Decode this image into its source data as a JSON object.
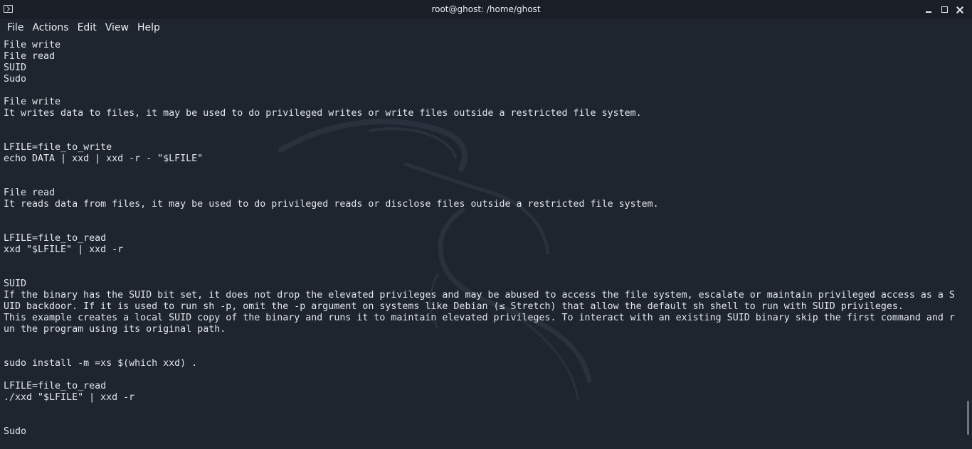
{
  "window": {
    "title": "root@ghost: /home/ghost"
  },
  "icons": {
    "app": "terminal-icon",
    "minimize": "minimize-icon",
    "maximize": "maximize-icon",
    "close": "close-icon"
  },
  "colors": {
    "background": "#1e252f",
    "titlebar": "#1a1f27",
    "text": "#e3e6ea",
    "scrollbar_thumb": "#6c7480"
  },
  "menu": {
    "file": "File",
    "actions": "Actions",
    "edit": "Edit",
    "view": "View",
    "help": "Help"
  },
  "terminal": {
    "lines": [
      "File write",
      "File read",
      "SUID",
      "Sudo",
      "",
      "File write",
      "It writes data to files, it may be used to do privileged writes or write files outside a restricted file system.",
      "",
      "",
      "LFILE=file_to_write",
      "echo DATA | xxd | xxd -r - \"$LFILE\"",
      "",
      "",
      "File read",
      "It reads data from files, it may be used to do privileged reads or disclose files outside a restricted file system.",
      "",
      "",
      "LFILE=file_to_read",
      "xxd \"$LFILE\" | xxd -r",
      "",
      "",
      "SUID",
      "If the binary has the SUID bit set, it does not drop the elevated privileges and may be abused to access the file system, escalate or maintain privileged access as a S",
      "UID backdoor. If it is used to run sh -p, omit the -p argument on systems like Debian (≤ Stretch) that allow the default sh shell to run with SUID privileges.",
      "This example creates a local SUID copy of the binary and runs it to maintain elevated privileges. To interact with an existing SUID binary skip the first command and r",
      "un the program using its original path.",
      "",
      "",
      "sudo install -m =xs $(which xxd) .",
      "",
      "LFILE=file_to_read",
      "./xxd \"$LFILE\" | xxd -r",
      "",
      "",
      "Sudo"
    ]
  }
}
